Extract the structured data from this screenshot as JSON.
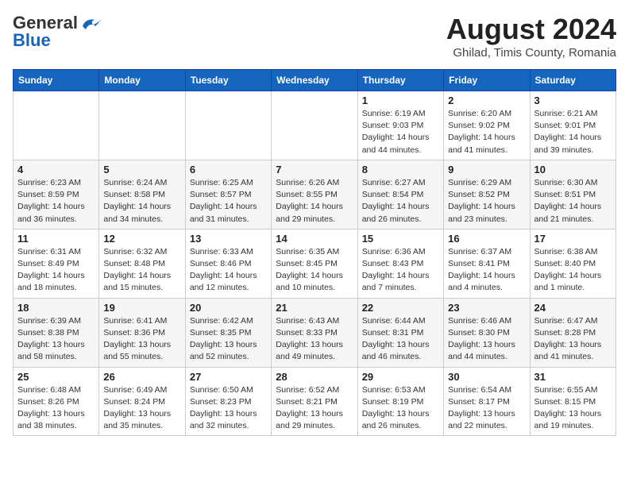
{
  "header": {
    "logo_general": "General",
    "logo_blue": "Blue",
    "month_year": "August 2024",
    "location": "Ghilad, Timis County, Romania"
  },
  "weekdays": [
    "Sunday",
    "Monday",
    "Tuesday",
    "Wednesday",
    "Thursday",
    "Friday",
    "Saturday"
  ],
  "weeks": [
    [
      {
        "day": "",
        "info": ""
      },
      {
        "day": "",
        "info": ""
      },
      {
        "day": "",
        "info": ""
      },
      {
        "day": "",
        "info": ""
      },
      {
        "day": "1",
        "info": "Sunrise: 6:19 AM\nSunset: 9:03 PM\nDaylight: 14 hours\nand 44 minutes."
      },
      {
        "day": "2",
        "info": "Sunrise: 6:20 AM\nSunset: 9:02 PM\nDaylight: 14 hours\nand 41 minutes."
      },
      {
        "day": "3",
        "info": "Sunrise: 6:21 AM\nSunset: 9:01 PM\nDaylight: 14 hours\nand 39 minutes."
      }
    ],
    [
      {
        "day": "4",
        "info": "Sunrise: 6:23 AM\nSunset: 8:59 PM\nDaylight: 14 hours\nand 36 minutes."
      },
      {
        "day": "5",
        "info": "Sunrise: 6:24 AM\nSunset: 8:58 PM\nDaylight: 14 hours\nand 34 minutes."
      },
      {
        "day": "6",
        "info": "Sunrise: 6:25 AM\nSunset: 8:57 PM\nDaylight: 14 hours\nand 31 minutes."
      },
      {
        "day": "7",
        "info": "Sunrise: 6:26 AM\nSunset: 8:55 PM\nDaylight: 14 hours\nand 29 minutes."
      },
      {
        "day": "8",
        "info": "Sunrise: 6:27 AM\nSunset: 8:54 PM\nDaylight: 14 hours\nand 26 minutes."
      },
      {
        "day": "9",
        "info": "Sunrise: 6:29 AM\nSunset: 8:52 PM\nDaylight: 14 hours\nand 23 minutes."
      },
      {
        "day": "10",
        "info": "Sunrise: 6:30 AM\nSunset: 8:51 PM\nDaylight: 14 hours\nand 21 minutes."
      }
    ],
    [
      {
        "day": "11",
        "info": "Sunrise: 6:31 AM\nSunset: 8:49 PM\nDaylight: 14 hours\nand 18 minutes."
      },
      {
        "day": "12",
        "info": "Sunrise: 6:32 AM\nSunset: 8:48 PM\nDaylight: 14 hours\nand 15 minutes."
      },
      {
        "day": "13",
        "info": "Sunrise: 6:33 AM\nSunset: 8:46 PM\nDaylight: 14 hours\nand 12 minutes."
      },
      {
        "day": "14",
        "info": "Sunrise: 6:35 AM\nSunset: 8:45 PM\nDaylight: 14 hours\nand 10 minutes."
      },
      {
        "day": "15",
        "info": "Sunrise: 6:36 AM\nSunset: 8:43 PM\nDaylight: 14 hours\nand 7 minutes."
      },
      {
        "day": "16",
        "info": "Sunrise: 6:37 AM\nSunset: 8:41 PM\nDaylight: 14 hours\nand 4 minutes."
      },
      {
        "day": "17",
        "info": "Sunrise: 6:38 AM\nSunset: 8:40 PM\nDaylight: 14 hours\nand 1 minute."
      }
    ],
    [
      {
        "day": "18",
        "info": "Sunrise: 6:39 AM\nSunset: 8:38 PM\nDaylight: 13 hours\nand 58 minutes."
      },
      {
        "day": "19",
        "info": "Sunrise: 6:41 AM\nSunset: 8:36 PM\nDaylight: 13 hours\nand 55 minutes."
      },
      {
        "day": "20",
        "info": "Sunrise: 6:42 AM\nSunset: 8:35 PM\nDaylight: 13 hours\nand 52 minutes."
      },
      {
        "day": "21",
        "info": "Sunrise: 6:43 AM\nSunset: 8:33 PM\nDaylight: 13 hours\nand 49 minutes."
      },
      {
        "day": "22",
        "info": "Sunrise: 6:44 AM\nSunset: 8:31 PM\nDaylight: 13 hours\nand 46 minutes."
      },
      {
        "day": "23",
        "info": "Sunrise: 6:46 AM\nSunset: 8:30 PM\nDaylight: 13 hours\nand 44 minutes."
      },
      {
        "day": "24",
        "info": "Sunrise: 6:47 AM\nSunset: 8:28 PM\nDaylight: 13 hours\nand 41 minutes."
      }
    ],
    [
      {
        "day": "25",
        "info": "Sunrise: 6:48 AM\nSunset: 8:26 PM\nDaylight: 13 hours\nand 38 minutes."
      },
      {
        "day": "26",
        "info": "Sunrise: 6:49 AM\nSunset: 8:24 PM\nDaylight: 13 hours\nand 35 minutes."
      },
      {
        "day": "27",
        "info": "Sunrise: 6:50 AM\nSunset: 8:23 PM\nDaylight: 13 hours\nand 32 minutes."
      },
      {
        "day": "28",
        "info": "Sunrise: 6:52 AM\nSunset: 8:21 PM\nDaylight: 13 hours\nand 29 minutes."
      },
      {
        "day": "29",
        "info": "Sunrise: 6:53 AM\nSunset: 8:19 PM\nDaylight: 13 hours\nand 26 minutes."
      },
      {
        "day": "30",
        "info": "Sunrise: 6:54 AM\nSunset: 8:17 PM\nDaylight: 13 hours\nand 22 minutes."
      },
      {
        "day": "31",
        "info": "Sunrise: 6:55 AM\nSunset: 8:15 PM\nDaylight: 13 hours\nand 19 minutes."
      }
    ]
  ]
}
